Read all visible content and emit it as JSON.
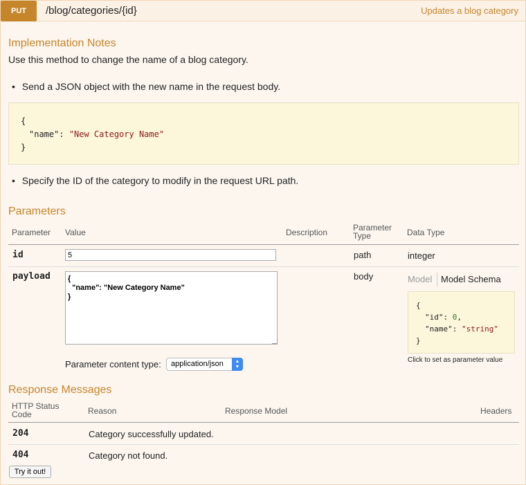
{
  "operation": {
    "method": "PUT",
    "path": "/blog/categories/{id}",
    "summary": "Updates a blog category"
  },
  "notes": {
    "heading": "Implementation Notes",
    "intro": "Use this method to change the name of a blog category.",
    "bullet1": "Send a JSON object with the new name in the request body.",
    "code_open": "{",
    "code_key": "\"name\"",
    "code_colon": ": ",
    "code_value": "\"New Category Name\"",
    "code_close": "}",
    "bullet2": "Specify the ID of the category to modify in the request URL path."
  },
  "parameters": {
    "heading": "Parameters",
    "headers": {
      "parameter": "Parameter",
      "value": "Value",
      "description": "Description",
      "param_type_line1": "Parameter",
      "param_type_line2": "Type",
      "data_type": "Data Type"
    },
    "rows": [
      {
        "name": "id",
        "value": "5",
        "param_type": "path",
        "data_type": "integer"
      },
      {
        "name": "payload",
        "value": "{\n  \"name\": \"New Category Name\"\n}",
        "param_type": "body"
      }
    ],
    "content_type_label": "Parameter content type:",
    "content_type_value": "application/json",
    "model_tab": "Model",
    "model_schema_tab": "Model Schema",
    "schema_open": "{",
    "schema_id_key": "\"id\"",
    "schema_id_value": "0",
    "schema_name_key": "\"name\"",
    "schema_name_value": "\"string\"",
    "schema_close": "}",
    "schema_hint": "Click to set as parameter value"
  },
  "responses": {
    "heading": "Response Messages",
    "headers": {
      "status_line1": "HTTP Status",
      "status_line2": "Code",
      "reason": "Reason",
      "model": "Response Model",
      "headers": "Headers"
    },
    "rows": [
      {
        "code": "204",
        "reason": "Category successfully updated."
      },
      {
        "code": "404",
        "reason": "Category not found."
      }
    ]
  },
  "try_button": "Try it out!"
}
